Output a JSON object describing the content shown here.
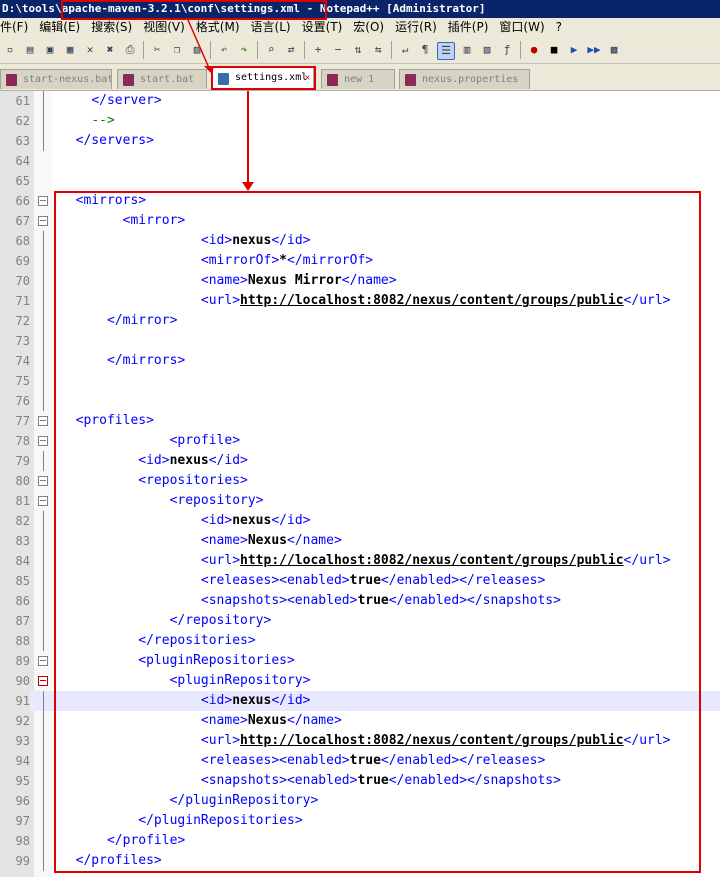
{
  "window": {
    "title": "D:\\tools\\apache-maven-3.2.1\\conf\\settings.xml - Notepad++ [Administrator]"
  },
  "menu": [
    "件(F)",
    "编辑(E)",
    "搜索(S)",
    "视图(V)",
    "格式(M)",
    "语言(L)",
    "设置(T)",
    "宏(O)",
    "运行(R)",
    "插件(P)",
    "窗口(W)",
    "?"
  ],
  "toolbar_icons": [
    "new-file-icon",
    "open-file-icon",
    "save-icon",
    "save-all-icon",
    "close-icon",
    "close-all-icon",
    "print-icon",
    "cut-icon",
    "copy-icon",
    "paste-icon",
    "undo-icon",
    "redo-icon",
    "find-icon",
    "replace-icon",
    "zoom-in-icon",
    "zoom-out-icon",
    "sync-vertical-icon",
    "sync-horizontal-icon",
    "word-wrap-icon",
    "show-all-chars-icon",
    "indent-guide-icon",
    "udl-icon",
    "doc-map-icon",
    "function-list-icon",
    "record-macro-icon",
    "stop-macro-icon",
    "play-macro-icon",
    "run-macro-multiple-icon",
    "save-macro-icon"
  ],
  "tabs": [
    {
      "label": "start-nexus.bat",
      "active": false
    },
    {
      "label": "start.bat",
      "active": false
    },
    {
      "label": "settings.xml",
      "active": true
    },
    {
      "label": "new 1",
      "active": false
    },
    {
      "label": "nexus.properties",
      "active": false
    }
  ],
  "editor": {
    "highlighted_line": 91,
    "lines": [
      {
        "n": "61",
        "i": 2,
        "t": [
          [
            "tag",
            "</server>"
          ]
        ]
      },
      {
        "n": "62",
        "i": 2,
        "t": [
          [
            "com",
            "-->"
          ]
        ]
      },
      {
        "n": "63",
        "i": 1,
        "t": [
          [
            "tag",
            "</servers>"
          ]
        ]
      },
      {
        "n": "64",
        "i": 0,
        "t": []
      },
      {
        "n": "65",
        "i": 0,
        "t": []
      },
      {
        "n": "66",
        "i": 1,
        "t": [
          [
            "tag",
            "<mirrors>"
          ]
        ]
      },
      {
        "n": "67",
        "i": 4,
        "t": [
          [
            "tag",
            "<mirror>"
          ]
        ]
      },
      {
        "n": "68",
        "i": 9,
        "t": [
          [
            "tag",
            "<id>"
          ],
          [
            "val",
            "nexus"
          ],
          [
            "tag",
            "</id>"
          ]
        ]
      },
      {
        "n": "69",
        "i": 9,
        "t": [
          [
            "tag",
            "<mirrorOf>"
          ],
          [
            "val",
            "*"
          ],
          [
            "tag",
            "</mirrorOf>"
          ]
        ]
      },
      {
        "n": "70",
        "i": 9,
        "t": [
          [
            "tag",
            "<name>"
          ],
          [
            "val",
            "Nexus Mirror"
          ],
          [
            "tag",
            "</name>"
          ]
        ]
      },
      {
        "n": "71",
        "i": 9,
        "t": [
          [
            "tag",
            "<url>"
          ],
          [
            "url",
            "http://localhost:8082/nexus/content/groups/public"
          ],
          [
            "tag",
            "</url>"
          ]
        ]
      },
      {
        "n": "72",
        "i": 3,
        "t": [
          [
            "tag",
            "</mirror>"
          ]
        ]
      },
      {
        "n": "73",
        "i": 0,
        "t": []
      },
      {
        "n": "74",
        "i": 3,
        "t": [
          [
            "tag",
            "</mirrors>"
          ]
        ]
      },
      {
        "n": "75",
        "i": 0,
        "t": []
      },
      {
        "n": "76",
        "i": 0,
        "t": []
      },
      {
        "n": "77",
        "i": 1,
        "t": [
          [
            "tag",
            "<profiles>"
          ]
        ]
      },
      {
        "n": "78",
        "i": 7,
        "t": [
          [
            "tag",
            "<profile>"
          ]
        ]
      },
      {
        "n": "79",
        "i": 5,
        "t": [
          [
            "tag",
            "<id>"
          ],
          [
            "val",
            "nexus"
          ],
          [
            "tag",
            "</id>"
          ]
        ]
      },
      {
        "n": "80",
        "i": 5,
        "t": [
          [
            "tag",
            "<repositories>"
          ]
        ]
      },
      {
        "n": "81",
        "i": 7,
        "t": [
          [
            "tag",
            "<repository>"
          ]
        ]
      },
      {
        "n": "82",
        "i": 9,
        "t": [
          [
            "tag",
            "<id>"
          ],
          [
            "val",
            "nexus"
          ],
          [
            "tag",
            "</id>"
          ]
        ]
      },
      {
        "n": "83",
        "i": 9,
        "t": [
          [
            "tag",
            "<name>"
          ],
          [
            "val",
            "Nexus"
          ],
          [
            "tag",
            "</name>"
          ]
        ]
      },
      {
        "n": "84",
        "i": 9,
        "t": [
          [
            "tag",
            "<url>"
          ],
          [
            "url",
            "http://localhost:8082/nexus/content/groups/public"
          ],
          [
            "tag",
            "</url>"
          ]
        ]
      },
      {
        "n": "85",
        "i": 9,
        "t": [
          [
            "tag",
            "<releases><enabled>"
          ],
          [
            "val",
            "true"
          ],
          [
            "tag",
            "</enabled></releases>"
          ]
        ]
      },
      {
        "n": "86",
        "i": 9,
        "t": [
          [
            "tag",
            "<snapshots><enabled>"
          ],
          [
            "val",
            "true"
          ],
          [
            "tag",
            "</enabled></snapshots>"
          ]
        ]
      },
      {
        "n": "87",
        "i": 7,
        "t": [
          [
            "tag",
            "</repository>"
          ]
        ]
      },
      {
        "n": "88",
        "i": 5,
        "t": [
          [
            "tag",
            "</repositories>"
          ]
        ]
      },
      {
        "n": "89",
        "i": 5,
        "t": [
          [
            "tag",
            "<pluginRepositories>"
          ]
        ]
      },
      {
        "n": "90",
        "i": 7,
        "t": [
          [
            "tag",
            "<pluginRepository>"
          ]
        ]
      },
      {
        "n": "91",
        "i": 9,
        "t": [
          [
            "tag",
            "<id>"
          ],
          [
            "val",
            "nexus"
          ],
          [
            "tag",
            "</id>"
          ]
        ]
      },
      {
        "n": "92",
        "i": 9,
        "t": [
          [
            "tag",
            "<name>"
          ],
          [
            "val",
            "Nexus"
          ],
          [
            "tag",
            "</name>"
          ]
        ]
      },
      {
        "n": "93",
        "i": 9,
        "t": [
          [
            "tag",
            "<url>"
          ],
          [
            "url",
            "http://localhost:8082/nexus/content/groups/public"
          ],
          [
            "tag",
            "</url>"
          ]
        ]
      },
      {
        "n": "94",
        "i": 9,
        "t": [
          [
            "tag",
            "<releases><enabled>"
          ],
          [
            "val",
            "true"
          ],
          [
            "tag",
            "</enabled></releases>"
          ]
        ]
      },
      {
        "n": "95",
        "i": 9,
        "t": [
          [
            "tag",
            "<snapshots><enabled>"
          ],
          [
            "val",
            "true"
          ],
          [
            "tag",
            "</enabled></snapshots>"
          ]
        ]
      },
      {
        "n": "96",
        "i": 7,
        "t": [
          [
            "tag",
            "</pluginRepository>"
          ]
        ]
      },
      {
        "n": "97",
        "i": 5,
        "t": [
          [
            "tag",
            "</pluginRepositories>"
          ]
        ]
      },
      {
        "n": "98",
        "i": 3,
        "t": [
          [
            "tag",
            "</profile>"
          ]
        ]
      },
      {
        "n": "99",
        "i": 1,
        "t": [
          [
            "tag",
            "</profiles>"
          ]
        ]
      }
    ],
    "fold_lines": [
      "66",
      "67",
      "77",
      "78",
      "80",
      "81",
      "89",
      "90"
    ]
  },
  "colors": {
    "annotation": "#e00000",
    "tag": "#0000ff",
    "comment": "#008000",
    "title_bar": "#0a246a"
  }
}
